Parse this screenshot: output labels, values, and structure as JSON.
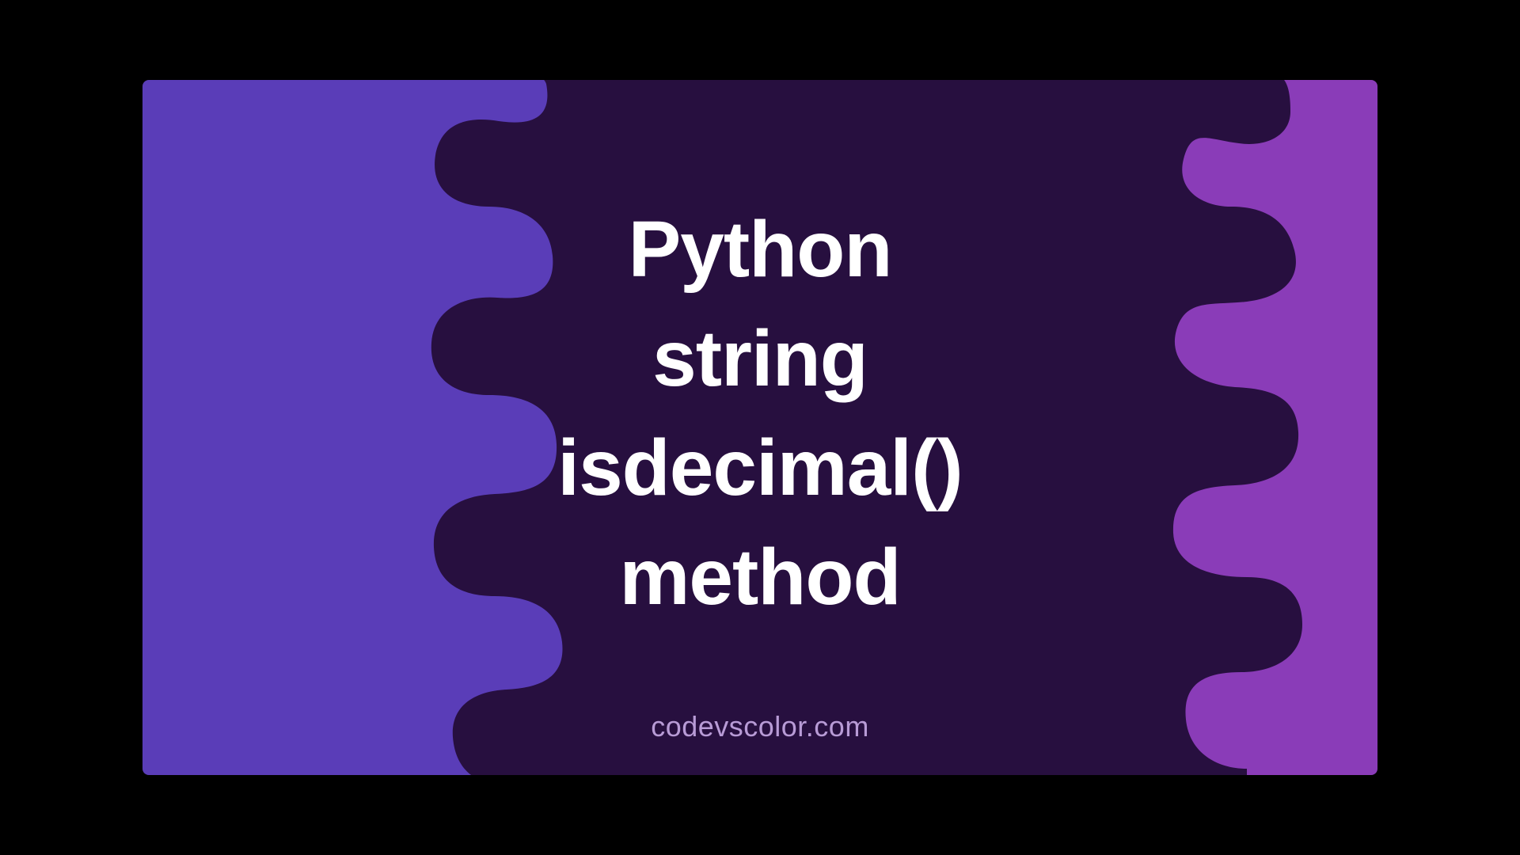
{
  "title_lines": [
    "Python",
    "string",
    "isdecimal()",
    "method"
  ],
  "title_joined": "Python\nstring\nisdecimal()\nmethod",
  "watermark": "codevscolor.com",
  "colors": {
    "bg_left": "#5a3db8",
    "bg_right": "#8a3cb8",
    "blob": "#270f3f",
    "title": "#ffffff",
    "watermark": "#b89bd6"
  }
}
